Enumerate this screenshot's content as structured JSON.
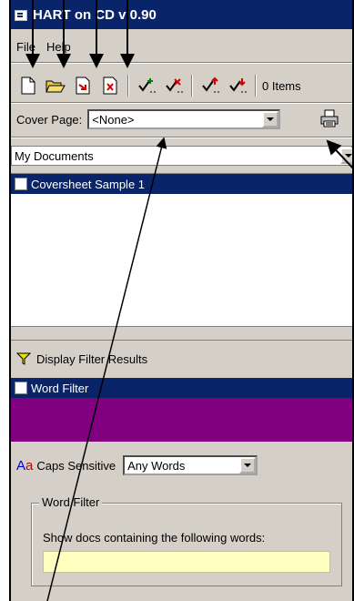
{
  "window": {
    "title": "HART on CD v 0.90"
  },
  "menu": {
    "file": "File",
    "help": "Help"
  },
  "toolbar": {
    "items_count": "0 Items"
  },
  "cover": {
    "label": "Cover Page:",
    "value": "<None>"
  },
  "location": {
    "value": "My Documents"
  },
  "documents": [
    {
      "label": "Coversheet Sample 1"
    }
  ],
  "filter": {
    "header": "Display Filter Results",
    "item": "Word Filter",
    "caps_label": "Caps Sensitive",
    "mode_value": "Any Words",
    "group_title": "Word Filter",
    "description": "Show docs containing the following words:",
    "input_value": ""
  },
  "colors": {
    "title_blue": "#0a246a",
    "filter_purple": "#800080",
    "input_yellow": "#ffffc0"
  }
}
